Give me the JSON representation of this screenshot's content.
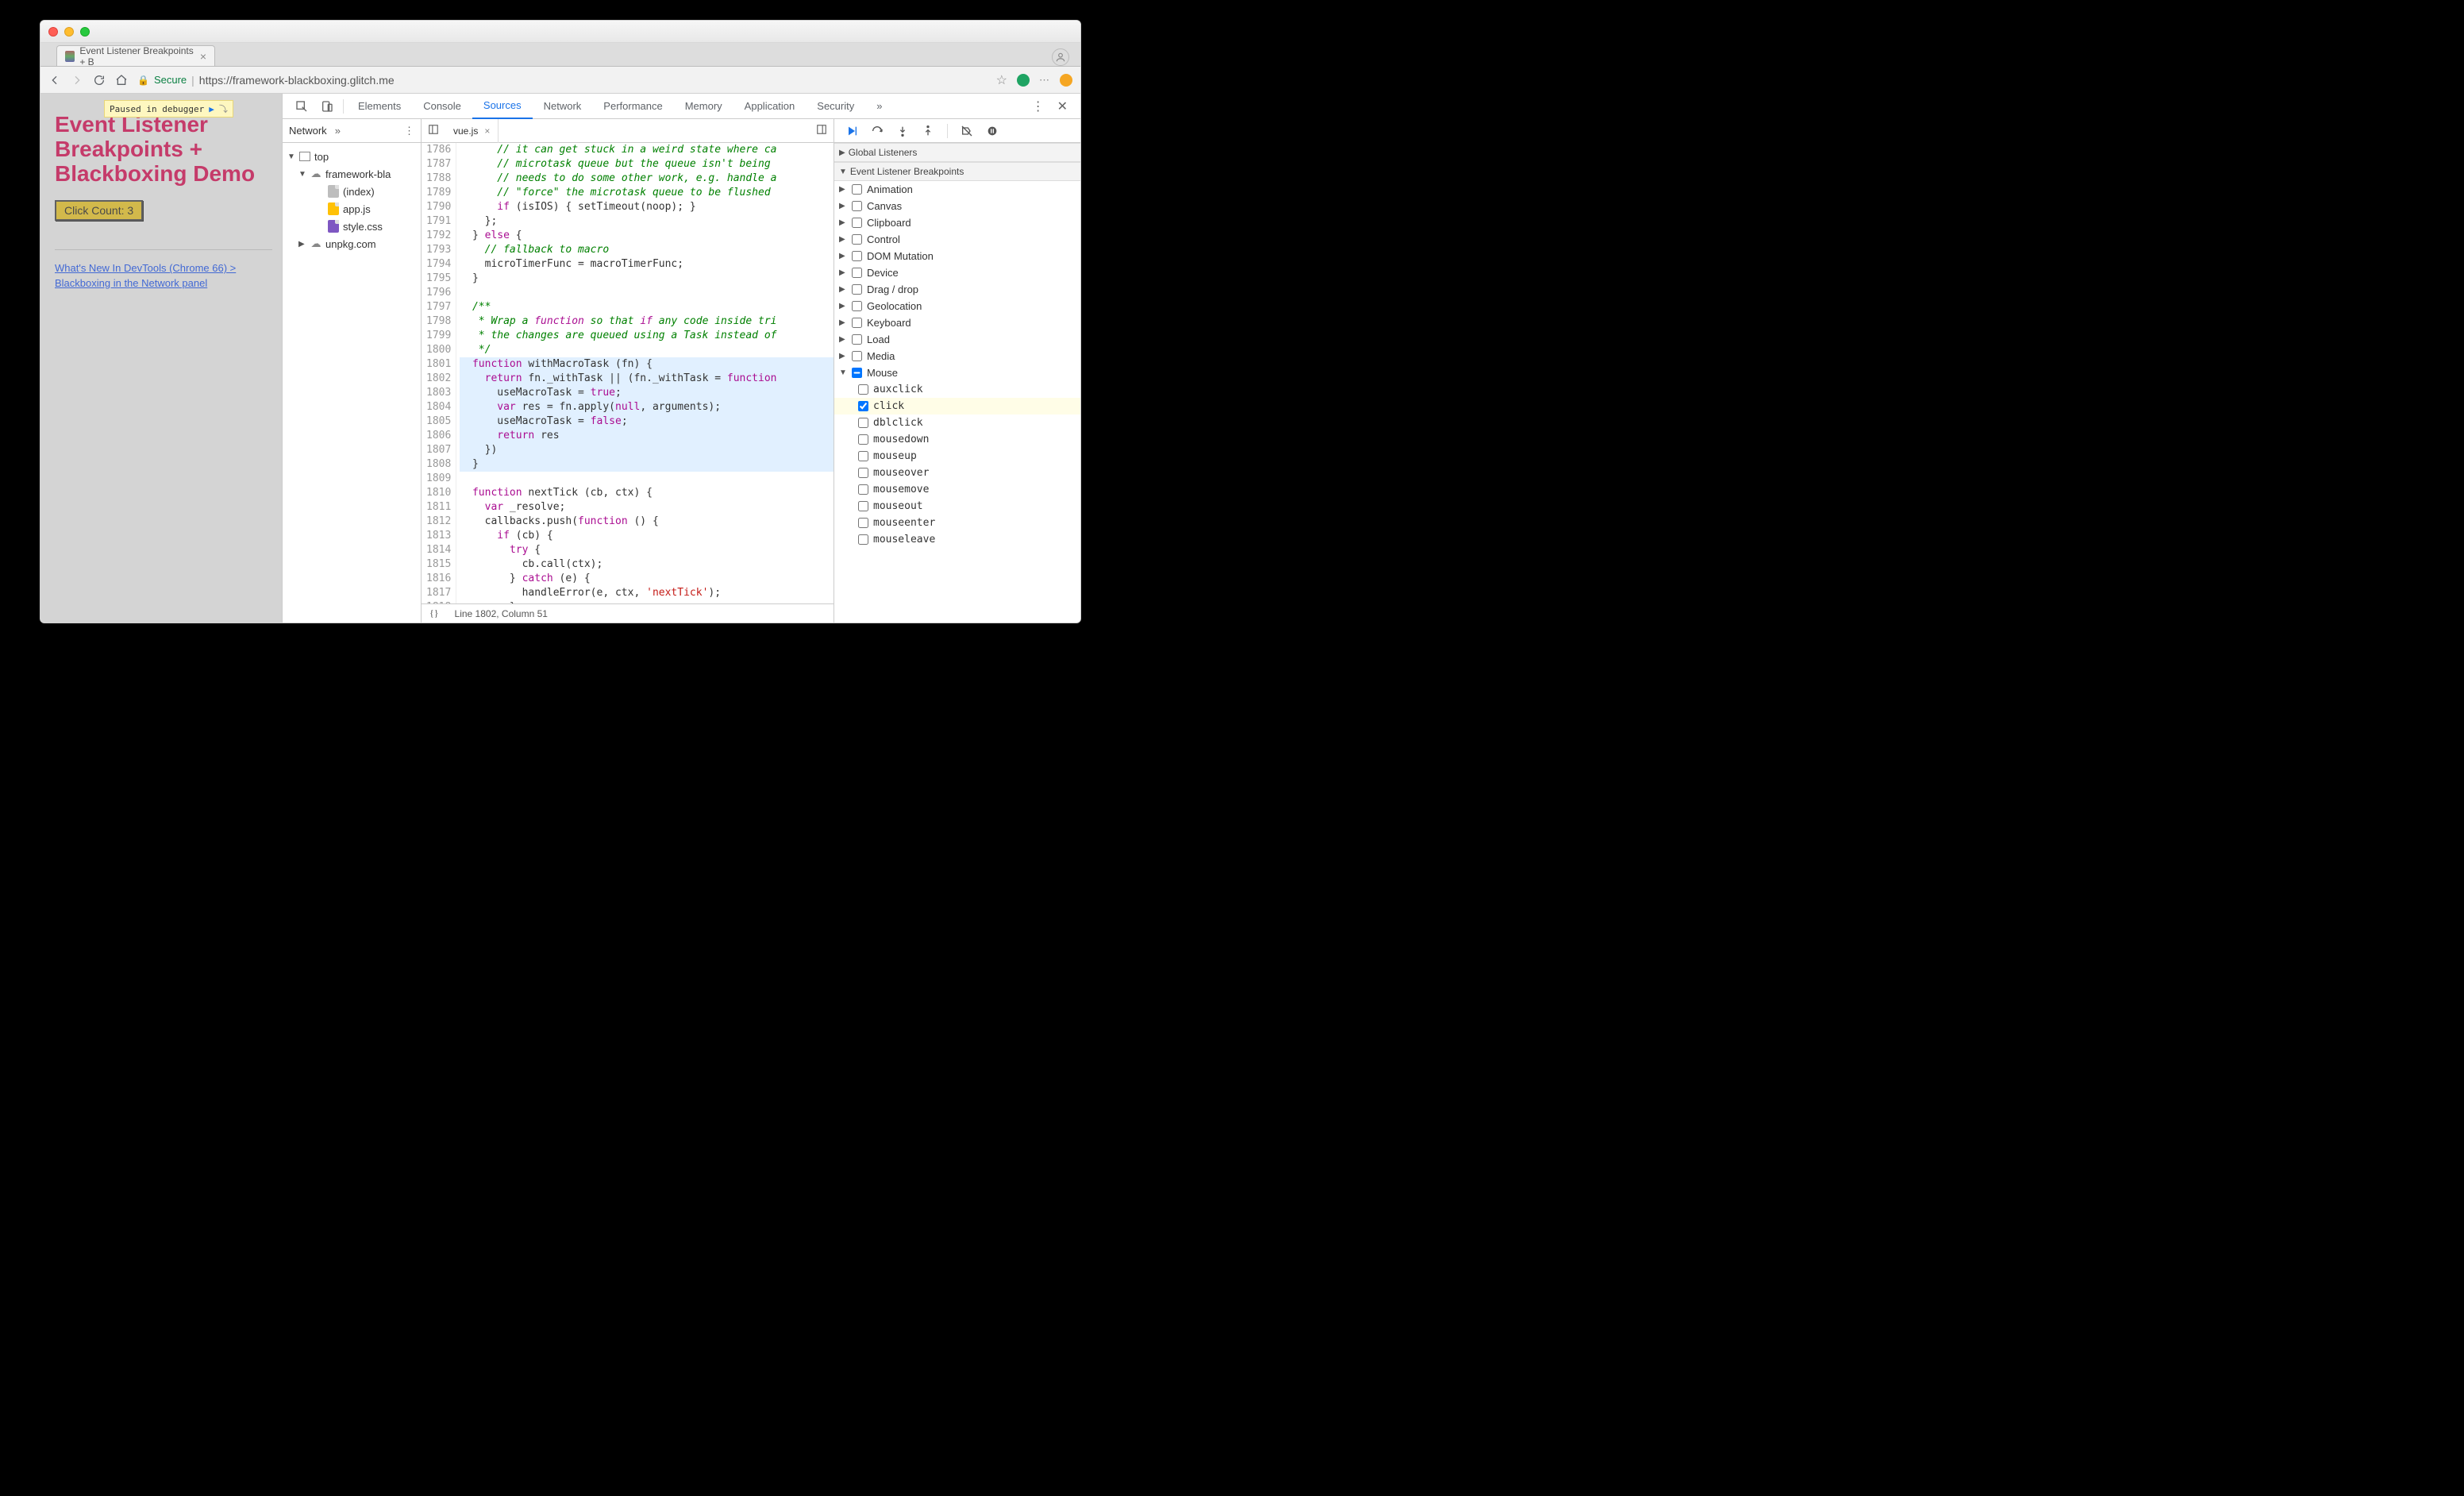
{
  "browser_tab": {
    "title": "Event Listener Breakpoints + B"
  },
  "url": {
    "secure_label": "Secure",
    "text": "https://framework-blackboxing.glitch.me"
  },
  "paused_label": "Paused in debugger",
  "page": {
    "heading": "Event Listener Breakpoints + Blackboxing Demo",
    "button": "Click Count: 3",
    "link": "What's New In DevTools (Chrome 66) > Blackboxing in the Network panel"
  },
  "devtools_tabs": [
    "Elements",
    "Console",
    "Sources",
    "Network",
    "Performance",
    "Memory",
    "Application",
    "Security"
  ],
  "navigator": {
    "top_label": "Network",
    "tree": {
      "top": "top",
      "domain": "framework-bla",
      "files": [
        "(index)",
        "app.js",
        "style.css"
      ],
      "external": "unpkg.com"
    }
  },
  "editor": {
    "tab": "vue.js",
    "status": {
      "braces": "{}",
      "pos": "Line 1802, Column 51"
    },
    "lines_start": 1786,
    "lines": [
      "      // it can get stuck in a weird state where ca",
      "      // microtask queue but the queue isn't being",
      "      // needs to do some other work, e.g. handle a",
      "      // \"force\" the microtask queue to be flushed",
      "      if (isIOS) { setTimeout(noop); }",
      "    };",
      "  } else {",
      "    // fallback to macro",
      "    microTimerFunc = macroTimerFunc;",
      "  }",
      "",
      "  /**",
      "   * Wrap a function so that if any code inside tri",
      "   * the changes are queued using a Task instead of",
      "   */",
      "  function withMacroTask (fn) {",
      "    return fn._withTask || (fn._withTask = function",
      "      useMacroTask = true;",
      "      var res = fn.apply(null, arguments);",
      "      useMacroTask = false;",
      "      return res",
      "    })",
      "  }",
      "",
      "  function nextTick (cb, ctx) {",
      "    var _resolve;",
      "    callbacks.push(function () {",
      "      if (cb) {",
      "        try {",
      "          cb.call(ctx);",
      "        } catch (e) {",
      "          handleError(e, ctx, 'nextTick');",
      "        }"
    ],
    "highlight_index": 16,
    "hl_block_start": 15,
    "hl_block_end": 22
  },
  "sidebar": {
    "sections": {
      "global": "Global Listeners",
      "elb": "Event Listener Breakpoints"
    },
    "categories": [
      {
        "name": "Animation",
        "expanded": false
      },
      {
        "name": "Canvas",
        "expanded": false
      },
      {
        "name": "Clipboard",
        "expanded": false
      },
      {
        "name": "Control",
        "expanded": false
      },
      {
        "name": "DOM Mutation",
        "expanded": false
      },
      {
        "name": "Device",
        "expanded": false
      },
      {
        "name": "Drag / drop",
        "expanded": false
      },
      {
        "name": "Geolocation",
        "expanded": false
      },
      {
        "name": "Keyboard",
        "expanded": false
      },
      {
        "name": "Load",
        "expanded": false
      },
      {
        "name": "Media",
        "expanded": false
      },
      {
        "name": "Mouse",
        "expanded": true,
        "mixed": true,
        "children": [
          {
            "name": "auxclick",
            "checked": false
          },
          {
            "name": "click",
            "checked": true,
            "hl": true
          },
          {
            "name": "dblclick",
            "checked": false
          },
          {
            "name": "mousedown",
            "checked": false
          },
          {
            "name": "mouseup",
            "checked": false
          },
          {
            "name": "mouseover",
            "checked": false
          },
          {
            "name": "mousemove",
            "checked": false
          },
          {
            "name": "mouseout",
            "checked": false
          },
          {
            "name": "mouseenter",
            "checked": false
          },
          {
            "name": "mouseleave",
            "checked": false
          }
        ]
      }
    ]
  }
}
